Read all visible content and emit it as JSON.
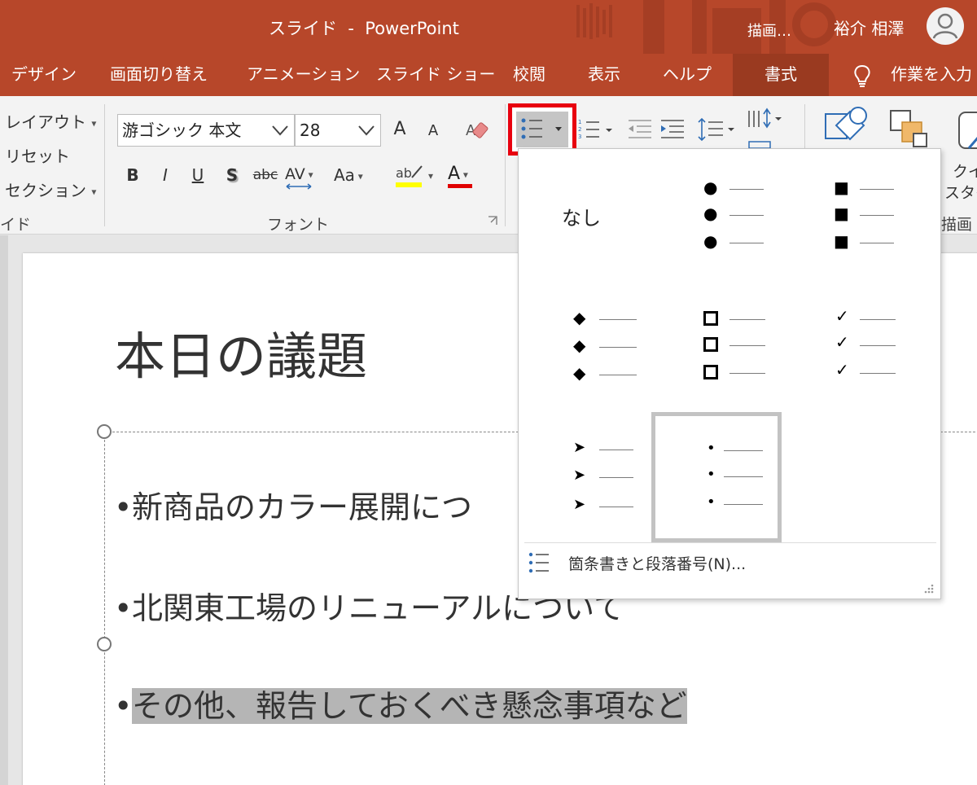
{
  "titlebar": {
    "title": "スライド  -  PowerPoint",
    "context_tab": "描画…",
    "user_name": "裕介 相澤",
    "avatar_icon": "person-icon"
  },
  "tabs": [
    {
      "label": "デザイン"
    },
    {
      "label": "画面切り替え"
    },
    {
      "label": "アニメーション"
    },
    {
      "label": "スライド ショー"
    },
    {
      "label": "校閲"
    },
    {
      "label": "表示"
    },
    {
      "label": "ヘルプ"
    },
    {
      "label": "書式",
      "active": true
    }
  ],
  "tell_me": {
    "label": "作業を入力",
    "icon": "lightbulb-icon"
  },
  "ribbon": {
    "slides_group": {
      "layout": "レイアウト",
      "reset": "リセット",
      "section": "セクション",
      "label": "イド"
    },
    "font_group": {
      "font_name": "游ゴシック 本文",
      "font_size": "28",
      "increase": "A",
      "decrease": "A",
      "bold": "B",
      "italic": "I",
      "underline": "U",
      "shadow": "S",
      "strike": "abc",
      "spacing": "AV",
      "case": "Aa",
      "font_color_letter": "A",
      "label": "フォント"
    },
    "drawing_group": {
      "quick_style_1": "クイ",
      "quick_style_2": "スタイ",
      "label": "描画"
    },
    "colors": {
      "highlight": "#ffff00",
      "font_color": "#e00000",
      "accent": "#b7472a",
      "bullet_btn_border": "#e8000f"
    }
  },
  "bullet_menu": {
    "none_label": "なし",
    "styles": [
      {
        "name": "none"
      },
      {
        "name": "filled-round-bullets",
        "glyph": "●"
      },
      {
        "name": "filled-square-bullets",
        "glyph": "■"
      },
      {
        "name": "diamond-bullets",
        "glyph": "◆"
      },
      {
        "name": "hollow-square-bullets",
        "glyph": "◻"
      },
      {
        "name": "checkmark-bullets",
        "glyph": "✓"
      },
      {
        "name": "arrow-bullets",
        "glyph": "➤"
      },
      {
        "name": "small-dot-bullets",
        "glyph": "•",
        "selected": true
      }
    ],
    "footer_label": "箇条書きと段落番号(N)..."
  },
  "slide": {
    "title": "本日の議題",
    "bullets": [
      {
        "text": "新商品のカラー展開につ",
        "selected": false
      },
      {
        "text": "北関東工場のリニューアルについて",
        "selected": false
      },
      {
        "text": "その他、報告しておくべき懸念事項など",
        "selected": true
      }
    ]
  }
}
